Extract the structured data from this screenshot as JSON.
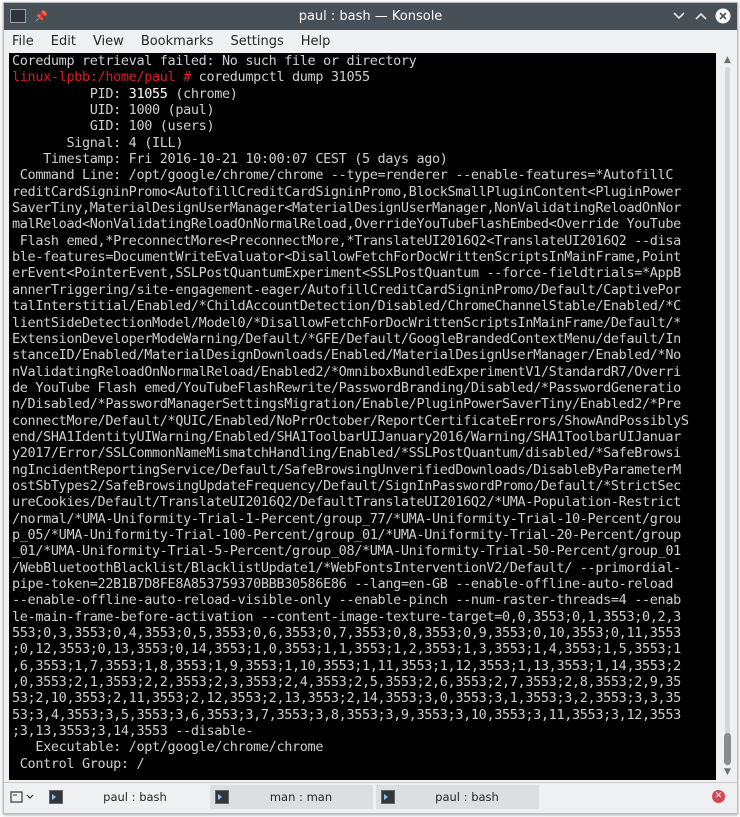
{
  "window": {
    "title": "paul : bash — Konsole"
  },
  "titlebar_icons": [
    "terminal-icon",
    "pin-icon",
    "minimize-icon",
    "maximize-icon",
    "close-icon"
  ],
  "menu": [
    "File",
    "Edit",
    "View",
    "Bookmarks",
    "Settings",
    "Help"
  ],
  "terminal": {
    "first_line": "Coredump retrieval failed: No such file or directory",
    "prompt": "linux-lpbb:/home/paul #",
    "command": " coredumpctl dump 31055",
    "pid_label": "          PID: ",
    "pid_value": "31055",
    "pid_rest": " (chrome)",
    "lines": [
      "          UID: 1000 (paul)",
      "          GID: 100 (users)",
      "       Signal: 4 (ILL)",
      "    Timestamp: Fri 2016-10-21 10:00:07 CEST (5 days ago)",
      " Command Line: /opt/google/chrome/chrome --type=renderer --enable-features=*AutofillC",
      "reditCardSigninPromo<AutofillCreditCardSigninPromo,BlockSmallPluginContent<PluginPower",
      "SaverTiny,MaterialDesignUserManager<MaterialDesignUserManager,NonValidatingReloadOnNor",
      "malReload<NonValidatingReloadOnNormalReload,OverrideYouTubeFlashEmbed<Override YouTube",
      " Flash emed,*PreconnectMore<PreconnectMore,*TranslateUI2016Q2<TranslateUI2016Q2 --disa",
      "ble-features=DocumentWriteEvaluator<DisallowFetchForDocWrittenScriptsInMainFrame,Point",
      "erEvent<PointerEvent,SSLPostQuantumExperiment<SSLPostQuantum --force-fieldtrials=*AppB",
      "annerTriggering/site-engagement-eager/AutofillCreditCardSigninPromo/Default/CaptivePor",
      "talInterstitial/Enabled/*ChildAccountDetection/Disabled/ChromeChannelStable/Enabled/*C",
      "lientSideDetectionModel/Model0/*DisallowFetchForDocWrittenScriptsInMainFrame/Default/*",
      "ExtensionDeveloperModeWarning/Default/*GFE/Default/GoogleBrandedContextMenu/default/In",
      "stanceID/Enabled/MaterialDesignDownloads/Enabled/MaterialDesignUserManager/Enabled/*No",
      "nValidatingReloadOnNormalReload/Enabled2/*OmniboxBundledExperimentV1/StandardR7/Overri",
      "de YouTube Flash emed/YouTubeFlashRewrite/PasswordBranding/Disabled/*PasswordGeneratio",
      "n/Disabled/*PasswordManagerSettingsMigration/Enable/PluginPowerSaverTiny/Enabled2/*Pre",
      "connectMore/Default/*QUIC/Enabled/NoPrrOctober/ReportCertificateErrors/ShowAndPossiblyS",
      "end/SHA1IdentityUIWarning/Enabled/SHA1ToolbarUIJanuary2016/Warning/SHA1ToolbarUIJanuar",
      "y2017/Error/SSLCommonNameMismatchHandling/Enabled/*SSLPostQuantum/disabled/*SafeBrowsi",
      "ngIncidentReportingService/Default/SafeBrowsingUnverifiedDownloads/DisableByParameterM",
      "ostSbTypes2/SafeBrowsingUpdateFrequency/Default/SignInPasswordPromo/Default/*StrictSec",
      "ureCookies/Default/TranslateUI2016Q2/DefaultTranslateUI2016Q2/*UMA-Population-Restrict",
      "/normal/*UMA-Uniformity-Trial-1-Percent/group_77/*UMA-Uniformity-Trial-10-Percent/grou",
      "p_05/*UMA-Uniformity-Trial-100-Percent/group_01/*UMA-Uniformity-Trial-20-Percent/group",
      "_01/*UMA-Uniformity-Trial-5-Percent/group_08/*UMA-Uniformity-Trial-50-Percent/group_01",
      "/WebBluetoothBlacklist/BlacklistUpdate1/*WebFontsInterventionV2/Default/ --primordial-",
      "pipe-token=22B1B7D8FE8A853759370BBB30586E86 --lang=en-GB --enable-offline-auto-reload",
      "--enable-offline-auto-reload-visible-only --enable-pinch --num-raster-threads=4 --enab",
      "le-main-frame-before-activation --content-image-texture-target=0,0,3553;0,1,3553;0,2,3",
      "553;0,3,3553;0,4,3553;0,5,3553;0,6,3553;0,7,3553;0,8,3553;0,9,3553;0,10,3553;0,11,3553",
      ";0,12,3553;0,13,3553;0,14,3553;1,0,3553;1,1,3553;1,2,3553;1,3,3553;1,4,3553;1,5,3553;1",
      ",6,3553;1,7,3553;1,8,3553;1,9,3553;1,10,3553;1,11,3553;1,12,3553;1,13,3553;1,14,3553;2",
      ",0,3553;2,1,3553;2,2,3553;2,3,3553;2,4,3553;2,5,3553;2,6,3553;2,7,3553;2,8,3553;2,9,35",
      "53;2,10,3553;2,11,3553;2,12,3553;2,13,3553;2,14,3553;3,0,3553;3,1,3553;3,2,3553;3,3,35",
      "53;3,4,3553;3,5,3553;3,6,3553;3,7,3553;3,8,3553;3,9,3553;3,10,3553;3,11,3553;3,12,3553",
      ";3,13,3553;3,14,3553 --disable-",
      "   Executable: /opt/google/chrome/chrome",
      " Control Group: /"
    ]
  },
  "tabs": [
    {
      "label": "paul : bash",
      "active": true
    },
    {
      "label": "man : man",
      "active": false
    },
    {
      "label": "paul : bash",
      "active": false
    }
  ],
  "colors": {
    "prompt": "#d81f1f",
    "terminal_bg": "#000000",
    "terminal_fg": "#cfcfcf",
    "titlebar": "#475057"
  }
}
